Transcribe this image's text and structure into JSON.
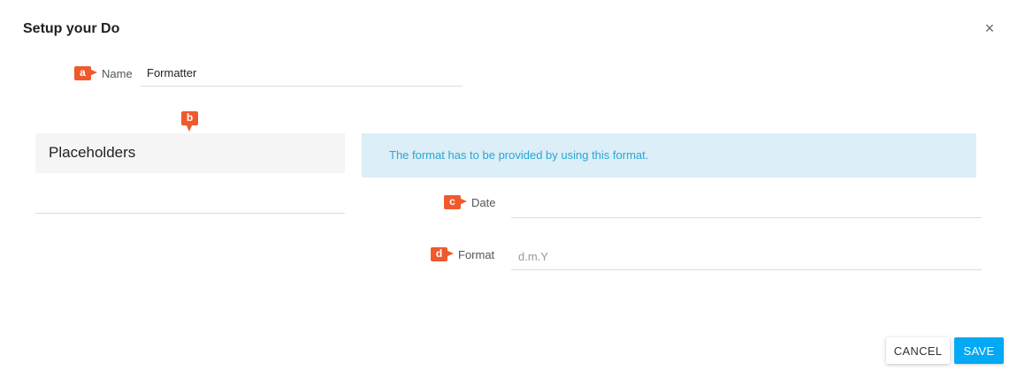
{
  "dialog": {
    "title": "Setup your Do",
    "close_glyph": "×"
  },
  "markers": {
    "a": "a",
    "b": "b",
    "c": "c",
    "d": "d"
  },
  "name_field": {
    "label": "Name",
    "value": "Formatter"
  },
  "placeholders_panel": {
    "title": "Placeholders"
  },
  "info_banner": {
    "text": "The format has to be provided by using this format."
  },
  "date_field": {
    "label": "Date",
    "value": ""
  },
  "format_field": {
    "label": "Format",
    "placeholder": "d.m.Y",
    "value": ""
  },
  "actions": {
    "cancel_label": "CANCEL",
    "save_label": "SAVE"
  },
  "colors": {
    "marker": "#ef5a2c",
    "info_background": "#dceef7",
    "info_text": "#29a6d6",
    "primary_button": "#03a9f4"
  },
  "icons": {
    "close": "close-icon"
  }
}
